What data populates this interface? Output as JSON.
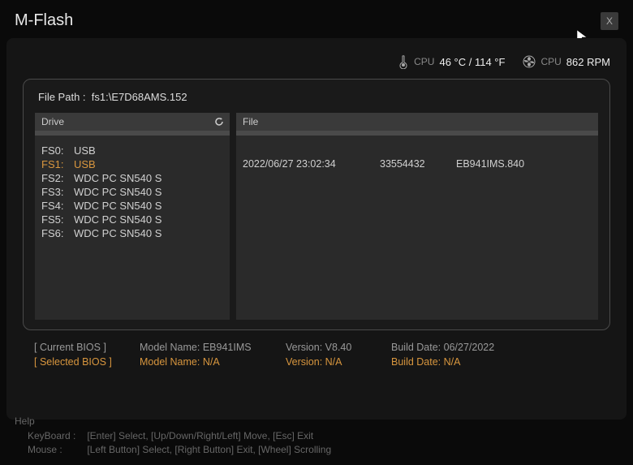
{
  "app_title": "M-Flash",
  "close_label": "X",
  "status": {
    "cpu_temp_label": "CPU",
    "cpu_temp": "46 °C / 114 °F",
    "cpu_fan_label": "CPU",
    "cpu_fan": "862 RPM"
  },
  "file_path_label": "File Path :",
  "file_path": "fs1:\\E7D68AMS.152",
  "drive_header": "Drive",
  "file_header": "File",
  "drives": [
    {
      "id": "FS0:",
      "name": "USB",
      "selected": false
    },
    {
      "id": "FS1:",
      "name": "USB",
      "selected": true
    },
    {
      "id": "FS2:",
      "name": "WDC PC SN540 S",
      "selected": false
    },
    {
      "id": "FS3:",
      "name": "WDC PC SN540 S",
      "selected": false
    },
    {
      "id": "FS4:",
      "name": "WDC PC SN540 S",
      "selected": false
    },
    {
      "id": "FS5:",
      "name": "WDC PC SN540 S",
      "selected": false
    },
    {
      "id": "FS6:",
      "name": "WDC PC SN540 S",
      "selected": false
    }
  ],
  "files": [
    {
      "date": "2022/06/27 23:02:34",
      "size": "33554432",
      "name": "EB941IMS.840"
    }
  ],
  "bios": {
    "current_label": "[ Current BIOS  ]",
    "selected_label": "[ Selected BIOS ]",
    "model_label": "Model Name:",
    "version_label": "Version:",
    "build_label": "Build Date:",
    "current": {
      "model": "EB941IMS",
      "version": "V8.40",
      "build": "06/27/2022"
    },
    "selected": {
      "model": "N/A",
      "version": "N/A",
      "build": "N/A"
    }
  },
  "help": {
    "title": "Help",
    "keyboard_label": "KeyBoard :",
    "keyboard": "[Enter]  Select,    [Up/Down/Right/Left]  Move,    [Esc]  Exit",
    "mouse_label": "Mouse     :",
    "mouse": "[Left Button]  Select,    [Right Button]  Exit,    [Wheel]  Scrolling"
  }
}
